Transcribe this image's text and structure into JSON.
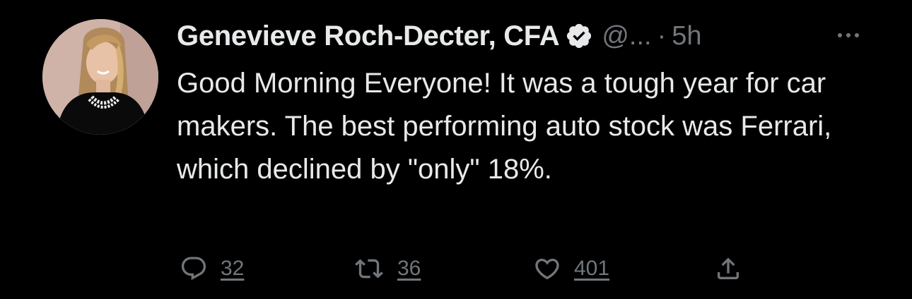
{
  "tweet": {
    "author": {
      "name": "Genevieve Roch-Decter, CFA",
      "verified_icon": "verified-badge-icon",
      "handle": "@...",
      "separator": "·",
      "time": "5h"
    },
    "more_icon": "more-options-icon",
    "text": "Good Morning Everyone! It was a tough year for car makers. The best performing auto stock was Ferrari, which declined by \"only\" 18%.",
    "actions": {
      "reply": {
        "icon": "reply-icon",
        "count": "32"
      },
      "retweet": {
        "icon": "retweet-icon",
        "count": "36"
      },
      "like": {
        "icon": "heart-icon",
        "count": "401"
      },
      "share": {
        "icon": "share-icon"
      }
    }
  },
  "colors": {
    "background": "#000000",
    "text": "#e7e9ea",
    "secondary": "#71767b"
  }
}
